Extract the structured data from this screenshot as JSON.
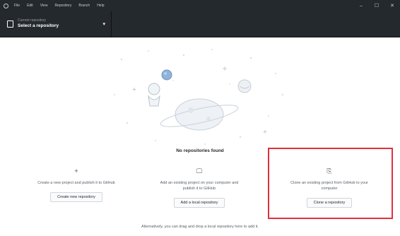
{
  "titlebar": {
    "menu": [
      "File",
      "Edit",
      "View",
      "Repository",
      "Branch",
      "Help"
    ],
    "controls": {
      "minimize": "–",
      "maximize": "☐",
      "close": "✕"
    }
  },
  "toolbar": {
    "repo_caption": "Current repository",
    "repo_value": "Select a repository",
    "chevron": "▾"
  },
  "empty_state": {
    "title": "No repositories found",
    "cards": [
      {
        "icon": "plus-icon",
        "glyph": "+",
        "description": "Create a new project and publish it to GitHub",
        "button": "Create new repository"
      },
      {
        "icon": "desktop-icon",
        "glyph": "🖵",
        "description": "Add an existing project on your computer and publish it to GitHub",
        "button": "Add a local repository"
      },
      {
        "icon": "repo-clone-icon",
        "glyph": "⎘",
        "description": "Clone an existing project from GitHub to your computer",
        "button": "Clone a repository"
      }
    ],
    "footer": "Alternatively, you can drag and drop a local repository here to add it."
  },
  "colors": {
    "titlebar": "#24292e",
    "highlight": "#e0303c",
    "text": "#24292e",
    "muted": "#586069"
  }
}
